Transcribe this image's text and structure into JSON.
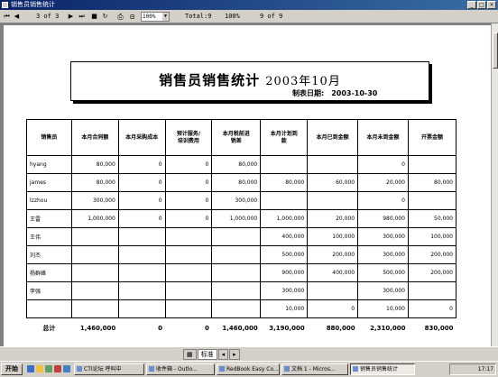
{
  "window": {
    "title": "销售员销售统计"
  },
  "toolbar": {
    "page_indicator": "3 of 3",
    "zoom": "100%",
    "total": "Total:9",
    "percent": "100%",
    "records": "9 of 9"
  },
  "report": {
    "title": "销售员销售统计",
    "period": "2003年10月",
    "make_date_label": "制表日期:",
    "make_date": "2003-10-30"
  },
  "table": {
    "headers": [
      "销售员",
      "本月合同额",
      "本月采购成本",
      "预计服务/\n培训费用",
      "本月税前进\n销差",
      "本月计划到\n款",
      "本月已到金额",
      "本月未到金额",
      "开票金额"
    ],
    "rows": [
      [
        "hyang",
        "80,000",
        "0",
        "0",
        "80,000",
        "",
        "",
        "0",
        ""
      ],
      [
        "james",
        "80,000",
        "0",
        "0",
        "80,000",
        "80,000",
        "60,000",
        "20,000",
        "80,000"
      ],
      [
        "lzzhou",
        "300,000",
        "0",
        "0",
        "300,000",
        "",
        "",
        "0",
        ""
      ],
      [
        "王雷",
        "1,000,000",
        "0",
        "0",
        "1,000,000",
        "1,000,000",
        "20,000",
        "980,000",
        "50,000"
      ],
      [
        "王伟",
        "",
        "",
        "",
        "",
        "400,000",
        "100,000",
        "300,000",
        "100,000"
      ],
      [
        "刘杰",
        "",
        "",
        "",
        "",
        "500,000",
        "200,000",
        "300,000",
        "200,000"
      ],
      [
        "杨群峰",
        "",
        "",
        "",
        "",
        "900,000",
        "400,000",
        "500,000",
        "200,000"
      ],
      [
        "李强",
        "",
        "",
        "",
        "",
        "300,000",
        "",
        "300,000",
        ""
      ],
      [
        "",
        "",
        "",
        "",
        "",
        "10,000",
        "0",
        "10,000",
        "0"
      ]
    ],
    "total": [
      "总计",
      "1,460,000",
      "0",
      "0",
      "1,460,000",
      "3,190,000",
      "880,000",
      "2,310,000",
      "830,000"
    ]
  },
  "sheetbar": {
    "tab_label": "标准"
  },
  "taskbar": {
    "start": "开始",
    "tasks": [
      "CTI论坛 呼叫中",
      "收件箱 - Outlo...",
      "RedBook Easy Co...",
      "文档 1 - Micros...",
      "销售员销售统计"
    ],
    "clock": "17:17"
  }
}
